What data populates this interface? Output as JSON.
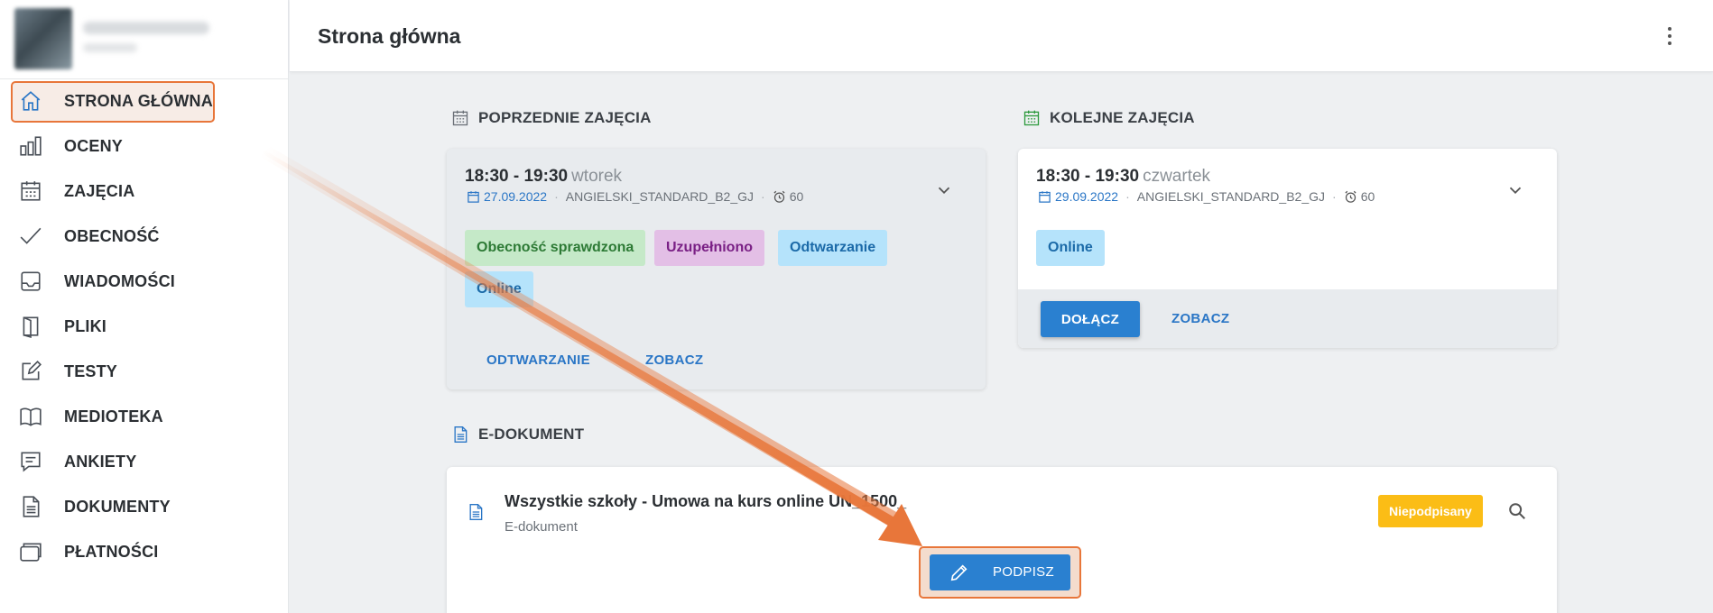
{
  "sidebar": {
    "items": [
      {
        "label": "STRONA GŁÓWNA",
        "icon": "home-icon"
      },
      {
        "label": "OCENY",
        "icon": "bar-chart-icon"
      },
      {
        "label": "ZAJĘCIA",
        "icon": "calendar-icon"
      },
      {
        "label": "OBECNOŚĆ",
        "icon": "check-icon"
      },
      {
        "label": "WIADOMOŚCI",
        "icon": "inbox-icon"
      },
      {
        "label": "PLIKI",
        "icon": "book-open-icon"
      },
      {
        "label": "TESTY",
        "icon": "edit-icon"
      },
      {
        "label": "MEDIOTEKA",
        "icon": "book-icon"
      },
      {
        "label": "ANKIETY",
        "icon": "survey-icon"
      },
      {
        "label": "DOKUMENTY",
        "icon": "document-icon"
      },
      {
        "label": "PŁATNOŚCI",
        "icon": "wallet-icon"
      }
    ]
  },
  "header": {
    "title": "Strona główna"
  },
  "previous": {
    "heading": "POPRZEDNIE ZAJĘCIA",
    "time": "18:30 - 19:30",
    "day": "wtorek",
    "date": "27.09.2022",
    "course": "ANGIELSKI_STANDARD_B2_GJ",
    "duration": "60",
    "badges": [
      "Obecność sprawdzona",
      "Uzupełniono",
      "Odtwarzanie",
      "Online"
    ],
    "actions": [
      "ODTWARZANIE",
      "ZOBACZ"
    ]
  },
  "next": {
    "heading": "KOLEJNE ZAJĘCIA",
    "time": "18:30 - 19:30",
    "day": "czwartek",
    "date": "29.09.2022",
    "course": "ANGIELSKI_STANDARD_B2_GJ",
    "duration": "60",
    "badges": [
      "Online"
    ],
    "actions": [
      "DOŁĄCZ",
      "ZOBACZ"
    ]
  },
  "edoc": {
    "heading": "E-DOKUMENT",
    "title": "Wszystkie szkoły - Umowa na kurs online UN_1500_",
    "subtitle": "E-dokument",
    "status": "Niepodpisany",
    "sign_label": "PODPISZ"
  },
  "colors": {
    "accent": "#2a80d0",
    "highlight": "#e8763a",
    "warning": "#fbbd16"
  }
}
